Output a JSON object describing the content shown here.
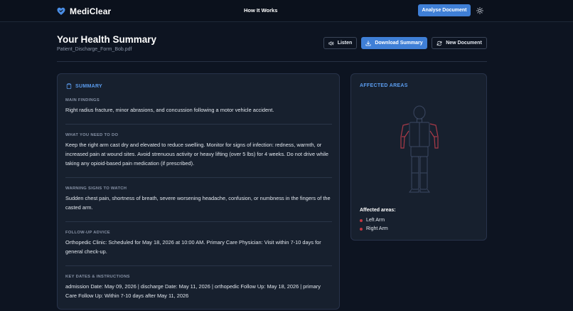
{
  "nav": {
    "brand": "MediClear",
    "link": "How It Works",
    "analyse_button": "Analyse Document"
  },
  "header": {
    "title": "Your Health Summary",
    "file": "Patient_Discharge_Form_Bob.pdf",
    "listen": "Listen",
    "download": "Download Summary",
    "new_doc": "New Document"
  },
  "summary": {
    "heading": "SUMMARY",
    "sections": [
      {
        "label": "MAIN FINDINGS",
        "text": "Right radius fracture, minor abrasions, and concussion following a motor vehicle accident."
      },
      {
        "label": "WHAT YOU NEED TO DO",
        "text": "Keep the right arm cast dry and elevated to reduce swelling. Monitor for signs of infection: redness, warmth, or increased pain at wound sites. Avoid strenuous activity or heavy lifting (over 5 lbs) for 4 weeks. Do not drive while taking any opioid-based pain medication (if prescribed)."
      },
      {
        "label": "WARNING SIGNS TO WATCH",
        "text": "Sudden chest pain, shortness of breath, severe worsening headache, confusion, or numbness in the fingers of the casted arm."
      },
      {
        "label": "FOLLOW-UP ADVICE",
        "text": "Orthopedic Clinic: Scheduled for May 18, 2026 at 10:00 AM. Primary Care Physician: Visit within 7-10 days for general check-up."
      },
      {
        "label": "KEY DATES & INSTRUCTIONS",
        "text": "admission Date: May 09, 2026 | discharge Date: May 11, 2026 | orthopedic Follow Up: May 18, 2026 | primary Care Follow Up: Within 7-10 days after May 11, 2026"
      }
    ]
  },
  "areas": {
    "heading": "AFFECTED AREAS",
    "subheading": "Affected areas:",
    "items": [
      "Left Arm",
      "Right Arm"
    ]
  },
  "colors": {
    "accent": "#3f7fd6",
    "heading_blue": "#5b9df0",
    "affected_red": "#c0353f",
    "background": "#0d1421",
    "card": "#17202e"
  }
}
